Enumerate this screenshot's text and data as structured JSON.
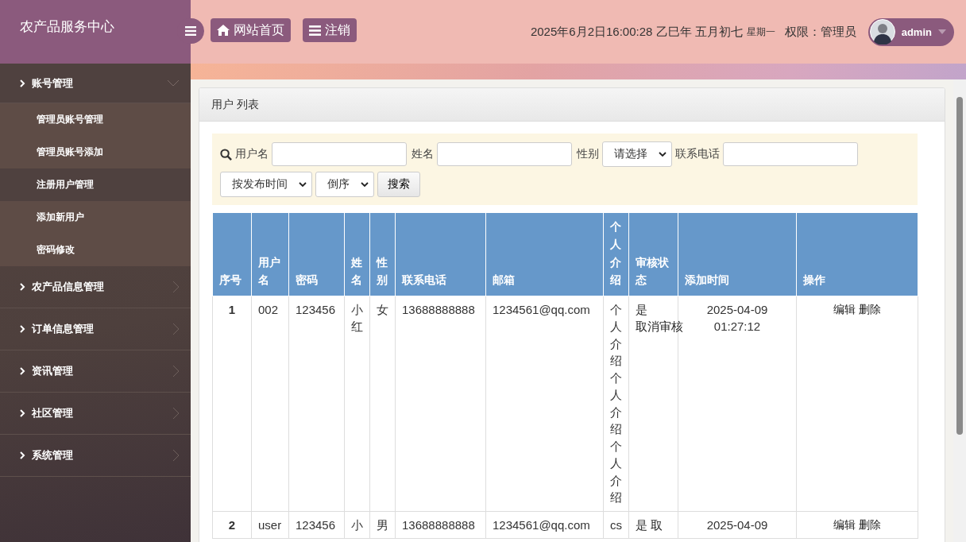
{
  "brand": "农产品服务中心",
  "header": {
    "buttons": [
      {
        "kind": "home",
        "label": "网站首页"
      },
      {
        "kind": "logout",
        "label": "注销"
      }
    ],
    "datetime": "2025年6月2日16:00:28 乙巳年 五月初七",
    "weekday": "星期一",
    "role": "权限：管理员",
    "user": "admin"
  },
  "sidebar": [
    {
      "label": "账号管理",
      "expanded": true,
      "children": [
        {
          "label": "管理员账号管理",
          "selected": false
        },
        {
          "label": "管理员账号添加",
          "selected": false
        },
        {
          "label": "注册用户管理",
          "selected": true
        },
        {
          "label": "添加新用户",
          "selected": false
        },
        {
          "label": "密码修改",
          "selected": false
        }
      ]
    },
    {
      "label": "农产品信息管理",
      "expanded": false
    },
    {
      "label": "订单信息管理",
      "expanded": false
    },
    {
      "label": "资讯管理",
      "expanded": false
    },
    {
      "label": "社区管理",
      "expanded": false
    },
    {
      "label": "系统管理",
      "expanded": false
    }
  ],
  "panel": {
    "title": "用户 列表"
  },
  "filters": {
    "fields": [
      {
        "label": "用户名",
        "kind": "text"
      },
      {
        "label": "姓名",
        "kind": "text"
      },
      {
        "label": "性别",
        "kind": "select",
        "value": "请选择"
      },
      {
        "label": "联系电话",
        "kind": "text"
      }
    ],
    "sort_field": "按发布时间",
    "sort_order": "倒序",
    "search_button": "搜索"
  },
  "table": {
    "columns": [
      "序号",
      "用户名",
      "密码",
      "姓名",
      "性别",
      "联系电话",
      "邮箱",
      "个人介绍",
      "审核状态",
      "添加时间",
      "操作"
    ],
    "rows": [
      {
        "index": "1",
        "username": "002",
        "password": "123456",
        "name": "小红",
        "gender": "女",
        "phone": "13688888888",
        "email": "1234561@qq.com",
        "intro": "个人介绍个人介绍个人介绍",
        "approved": "是",
        "toggle": "取消审核",
        "added": "2025-04-09 01:27:12",
        "actions": [
          "编辑",
          "删除"
        ]
      },
      {
        "index": "2",
        "username": "user",
        "password": "123456",
        "name": "小",
        "gender": "男",
        "phone": "13688888888",
        "email": "1234561@qq.com",
        "intro": "cs",
        "approved": "是",
        "toggle": "取",
        "added": "2025-04-09",
        "actions": [
          "编辑",
          "删除"
        ]
      }
    ]
  }
}
